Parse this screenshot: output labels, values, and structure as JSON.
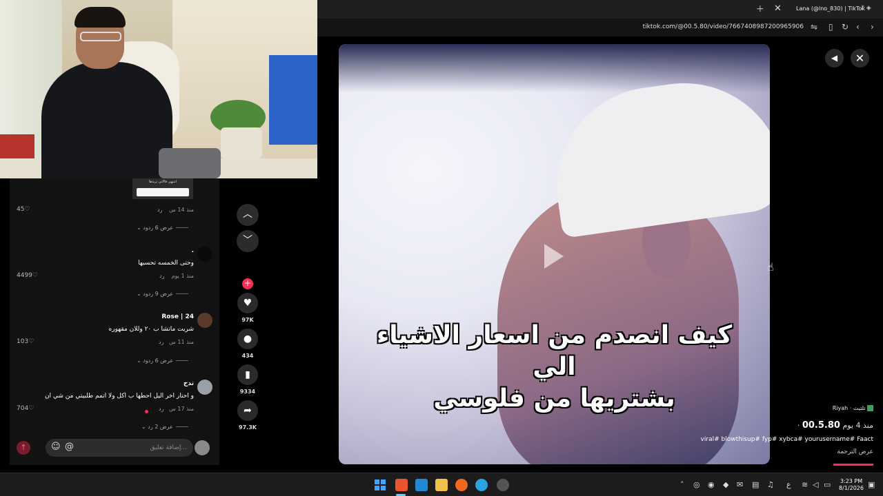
{
  "browser": {
    "tab_title": "Lana (@lno_830) | TikTok",
    "new_tab": "+",
    "close_tab": "✕",
    "url": "tiktok.com/@00.5.80/video/7667408987200965906"
  },
  "video": {
    "caption_line1": "كيف انصدم من اسعار الاشياء الي",
    "caption_line2": "بشتريها من فلوسي",
    "music": "Riyah · تلتيث",
    "author": "00.5.80",
    "author_meta": "· منذ 4 يوم",
    "hashtags": "viral# blowthisup# fyp# xybca# yourusername# Faact",
    "translate": "عرض الترجمة",
    "progress": 0.05
  },
  "actions": {
    "likes": "97K",
    "comments": "434",
    "saves": "9334",
    "shares": "97.3K"
  },
  "comments": {
    "thumb_text": "انتبهي فالاتي تريدها",
    "items": [
      {
        "name": "",
        "text": "",
        "time": "منذ 14 س",
        "reply": "رد",
        "likes": "45",
        "more": "عرض 6 ردود",
        "avatar_color": "#333"
      },
      {
        "name": ".",
        "text": "وحتى الخمسه تحسبها",
        "time": "منذ 1 يوم",
        "reply": "رد",
        "likes": "4499",
        "more": "عرض 9 ردود",
        "avatar_color": "#0a0a0a"
      },
      {
        "name": "Rose | 24",
        "text": "شريت ماتشا ب ٢٠ وللان مقهوره",
        "time": "منذ 11 س",
        "reply": "رد",
        "likes": "103",
        "more": "عرض 6 ردود",
        "avatar_color": "#5a3a2a"
      },
      {
        "name": "تدح",
        "text": "و احتار اخر اليل احطها ب اكل ولا اتمم طلبيتي من شي ان",
        "time": "منذ 17 س",
        "reply": "رد",
        "likes": "704",
        "more": "عرض 2 رد",
        "avatar_color": "#9aa0a8"
      }
    ],
    "input_placeholder": "إضافة تعليق...",
    "mention_symbol": "@",
    "emoji_symbol": "☺"
  },
  "taskbar": {
    "time": "3:23 PM",
    "date": "8/1/2026",
    "lang": "ع"
  },
  "colors": {
    "accent": "#fe2c55",
    "panel": "#121212",
    "button": "#2a2a2a"
  }
}
